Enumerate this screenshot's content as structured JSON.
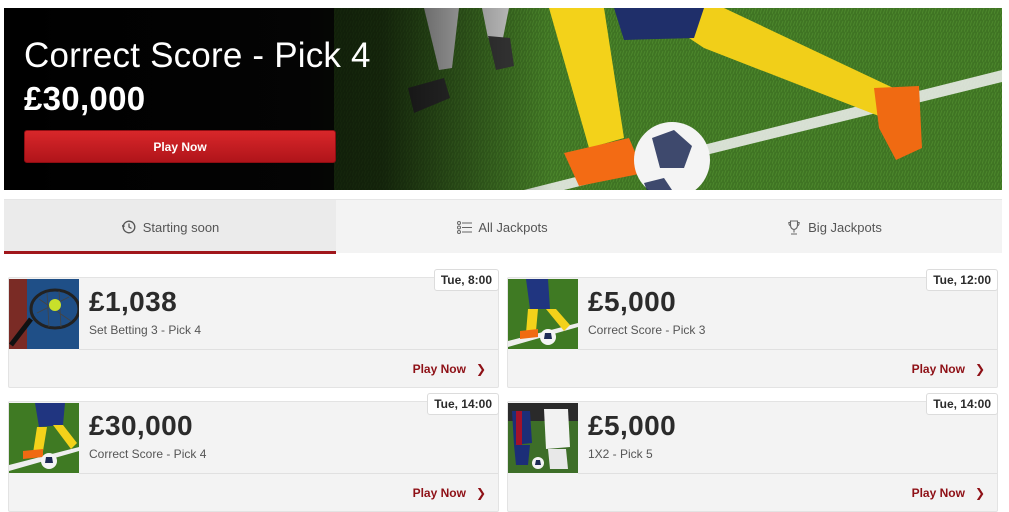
{
  "hero": {
    "title": "Correct Score - Pick 4",
    "amount": "£30,000",
    "cta": "Play Now"
  },
  "tabs": [
    {
      "label": "Starting soon",
      "icon": "clock-icon",
      "active": true
    },
    {
      "label": "All Jackpots",
      "icon": "list-icon",
      "active": false
    },
    {
      "label": "Big Jackpots",
      "icon": "trophy-icon",
      "active": false
    }
  ],
  "jackpots": [
    {
      "time": "Tue, 8:00",
      "amount": "£1,038",
      "game": "Set Betting 3 - Pick 4",
      "cta": "Play Now",
      "image": "tennis"
    },
    {
      "time": "Tue, 12:00",
      "amount": "£5,000",
      "game": "Correct Score - Pick 3",
      "cta": "Play Now",
      "image": "football"
    },
    {
      "time": "Tue, 14:00",
      "amount": "£30,000",
      "game": "Correct Score - Pick 4",
      "cta": "Play Now",
      "image": "football"
    },
    {
      "time": "Tue, 14:00",
      "amount": "£5,000",
      "game": "1X2 - Pick 5",
      "cta": "Play Now",
      "image": "football-players"
    }
  ],
  "colors": {
    "accent": "#a0161b",
    "button": "#c41e24",
    "link": "#8e1016"
  }
}
